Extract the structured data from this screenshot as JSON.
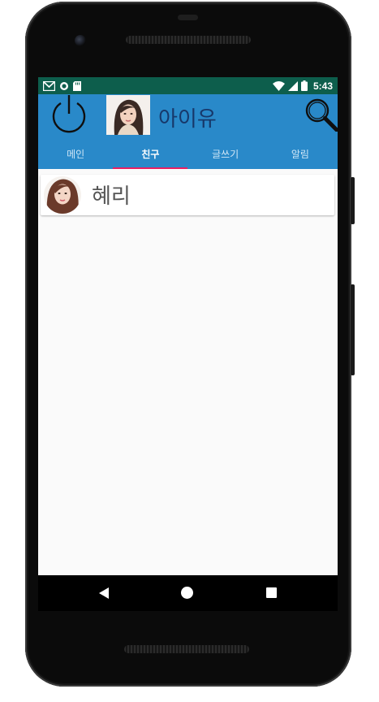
{
  "status_bar": {
    "time": "5:43",
    "icons_left": [
      "gmail-icon",
      "sync-icon",
      "sd-card-icon"
    ],
    "icons_right": [
      "wifi-icon",
      "signal-icon",
      "battery-icon"
    ],
    "color": "#0d5e4c"
  },
  "app_bar": {
    "user_name": "아이유",
    "color": "#2989c9"
  },
  "tabs": [
    {
      "label": "메인",
      "active": false
    },
    {
      "label": "친구",
      "active": true
    },
    {
      "label": "글쓰기",
      "active": false
    },
    {
      "label": "알림",
      "active": false
    }
  ],
  "friends": [
    {
      "name": "혜리"
    }
  ],
  "accent_color": "#e91e63"
}
